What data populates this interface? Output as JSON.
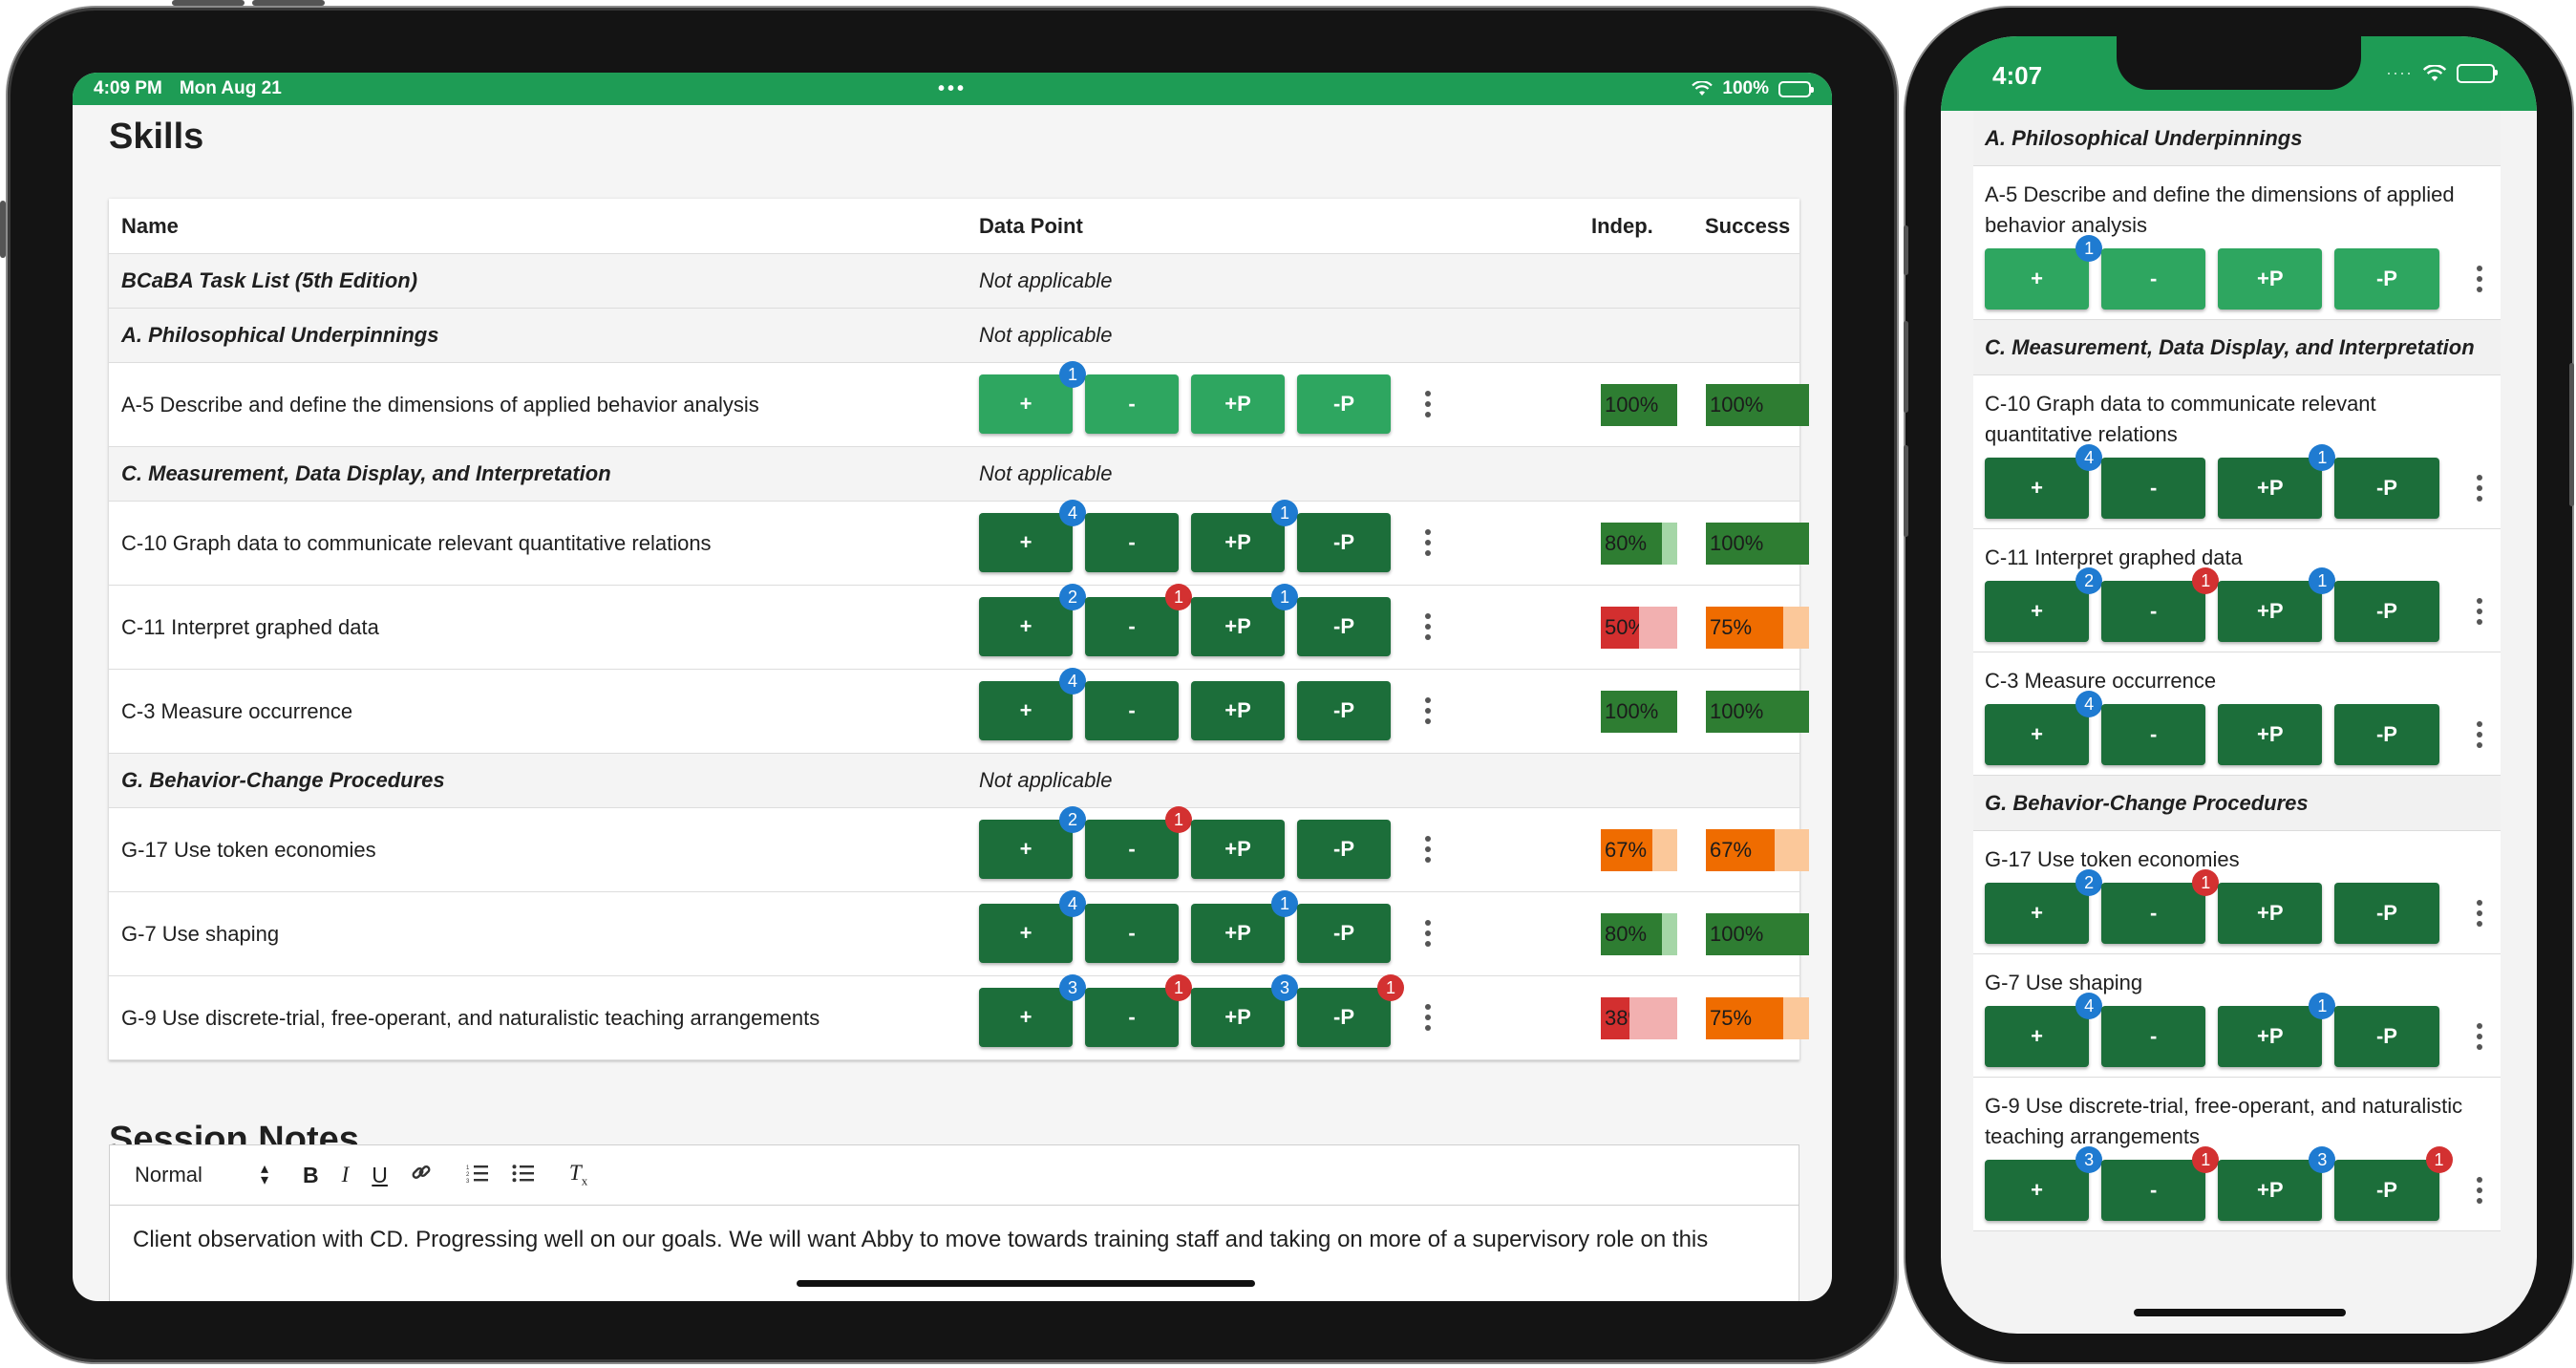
{
  "ipad": {
    "status": {
      "time": "4:09 PM",
      "date": "Mon Aug 21",
      "battery": "100%"
    },
    "skills_title": "Skills",
    "table_headers": {
      "name": "Name",
      "data_point": "Data Point",
      "indep": "Indep.",
      "success": "Success"
    },
    "rows": [
      {
        "type": "group",
        "name": "BCaBA Task List (5th Edition)",
        "data_point": "Not applicable"
      },
      {
        "type": "group",
        "name": "A. Philosophical Underpinnings",
        "data_point": "Not applicable"
      },
      {
        "type": "skill",
        "name": "A-5 Describe and define the dimensions of applied behavior analysis",
        "style": "light",
        "buttons": [
          {
            "label": "+",
            "badge": "1",
            "badge_color": "blue"
          },
          {
            "label": "-"
          },
          {
            "label": "+P"
          },
          {
            "label": "-P"
          }
        ],
        "indep": {
          "label": "100%",
          "value": 1.0,
          "fg": "#2e7d32",
          "bg": "#a5d6a7"
        },
        "success": {
          "label": "100%",
          "value": 1.0,
          "fg": "#2e7d32",
          "bg": "#a5d6a7"
        }
      },
      {
        "type": "group",
        "name": "C. Measurement, Data Display, and Interpretation",
        "data_point": "Not applicable"
      },
      {
        "type": "skill",
        "name": "C-10 Graph data to communicate relevant quantitative relations",
        "style": "dark",
        "buttons": [
          {
            "label": "+",
            "badge": "4",
            "badge_color": "blue"
          },
          {
            "label": "-"
          },
          {
            "label": "+P",
            "badge": "1",
            "badge_color": "blue"
          },
          {
            "label": "-P"
          }
        ],
        "indep": {
          "label": "80%",
          "value": 0.8,
          "fg": "#2e7d32",
          "bg": "#a5d6a7"
        },
        "success": {
          "label": "100%",
          "value": 1.0,
          "fg": "#2e7d32",
          "bg": "#a5d6a7"
        }
      },
      {
        "type": "skill",
        "name": "C-11 Interpret graphed data",
        "style": "dark",
        "buttons": [
          {
            "label": "+",
            "badge": "2",
            "badge_color": "blue"
          },
          {
            "label": "-",
            "badge": "1",
            "badge_color": "red"
          },
          {
            "label": "+P",
            "badge": "1",
            "badge_color": "blue"
          },
          {
            "label": "-P"
          }
        ],
        "indep": {
          "label": "50%",
          "value": 0.5,
          "fg": "#d32f2f",
          "bg": "#f2b0b0"
        },
        "success": {
          "label": "75%",
          "value": 0.75,
          "fg": "#ef6c00",
          "bg": "#fbc89a"
        }
      },
      {
        "type": "skill",
        "name": "C-3 Measure occurrence",
        "style": "dark",
        "buttons": [
          {
            "label": "+",
            "badge": "4",
            "badge_color": "blue"
          },
          {
            "label": "-"
          },
          {
            "label": "+P"
          },
          {
            "label": "-P"
          }
        ],
        "indep": {
          "label": "100%",
          "value": 1.0,
          "fg": "#2e7d32",
          "bg": "#a5d6a7"
        },
        "success": {
          "label": "100%",
          "value": 1.0,
          "fg": "#2e7d32",
          "bg": "#a5d6a7"
        }
      },
      {
        "type": "group",
        "name": "G. Behavior-Change Procedures",
        "data_point": "Not applicable"
      },
      {
        "type": "skill",
        "name": "G-17 Use token economies",
        "style": "dark",
        "buttons": [
          {
            "label": "+",
            "badge": "2",
            "badge_color": "blue"
          },
          {
            "label": "-",
            "badge": "1",
            "badge_color": "red"
          },
          {
            "label": "+P"
          },
          {
            "label": "-P"
          }
        ],
        "indep": {
          "label": "67%",
          "value": 0.67,
          "fg": "#ef6c00",
          "bg": "#fbc89a"
        },
        "success": {
          "label": "67%",
          "value": 0.67,
          "fg": "#ef6c00",
          "bg": "#fbc89a"
        }
      },
      {
        "type": "skill",
        "name": "G-7 Use shaping",
        "style": "dark",
        "buttons": [
          {
            "label": "+",
            "badge": "4",
            "badge_color": "blue"
          },
          {
            "label": "-"
          },
          {
            "label": "+P",
            "badge": "1",
            "badge_color": "blue"
          },
          {
            "label": "-P"
          }
        ],
        "indep": {
          "label": "80%",
          "value": 0.8,
          "fg": "#2e7d32",
          "bg": "#a5d6a7"
        },
        "success": {
          "label": "100%",
          "value": 1.0,
          "fg": "#2e7d32",
          "bg": "#a5d6a7"
        }
      },
      {
        "type": "skill",
        "name": "G-9 Use discrete-trial, free-operant, and naturalistic teaching arrangements",
        "style": "dark",
        "buttons": [
          {
            "label": "+",
            "badge": "3",
            "badge_color": "blue"
          },
          {
            "label": "-",
            "badge": "1",
            "badge_color": "red"
          },
          {
            "label": "+P",
            "badge": "3",
            "badge_color": "blue"
          },
          {
            "label": "-P",
            "badge": "1",
            "badge_color": "red"
          }
        ],
        "indep": {
          "label": "38%",
          "value": 0.38,
          "fg": "#d32f2f",
          "bg": "#f2b0b0"
        },
        "success": {
          "label": "75%",
          "value": 0.75,
          "fg": "#ef6c00",
          "bg": "#fbc89a"
        }
      }
    ],
    "notes_title": "Session Notes",
    "editor": {
      "format": "Normal",
      "text": "Client observation with CD. Progressing well on our goals. We will want Abby to move towards training staff and taking on more of a supervisory role on this"
    }
  },
  "iphone": {
    "status": {
      "time": "4:07"
    },
    "rows": [
      {
        "type": "group",
        "name": "A. Philosophical Underpinnings"
      },
      {
        "type": "skill",
        "name": "A-5 Describe and define the dimensions of applied behavior analysis",
        "style": "light",
        "buttons": [
          {
            "label": "+",
            "badge": "1",
            "badge_color": "blue"
          },
          {
            "label": "-"
          },
          {
            "label": "+P"
          },
          {
            "label": "-P"
          }
        ]
      },
      {
        "type": "group",
        "name": "C. Measurement, Data Display, and Interpretation"
      },
      {
        "type": "skill",
        "name": "C-10 Graph data to communicate relevant quantitative relations",
        "style": "dark",
        "buttons": [
          {
            "label": "+",
            "badge": "4",
            "badge_color": "blue"
          },
          {
            "label": "-"
          },
          {
            "label": "+P",
            "badge": "1",
            "badge_color": "blue"
          },
          {
            "label": "-P"
          }
        ]
      },
      {
        "type": "skill",
        "name": "C-11 Interpret graphed data",
        "style": "dark",
        "buttons": [
          {
            "label": "+",
            "badge": "2",
            "badge_color": "blue"
          },
          {
            "label": "-",
            "badge": "1",
            "badge_color": "red"
          },
          {
            "label": "+P",
            "badge": "1",
            "badge_color": "blue"
          },
          {
            "label": "-P"
          }
        ]
      },
      {
        "type": "skill",
        "name": "C-3 Measure occurrence",
        "style": "dark",
        "buttons": [
          {
            "label": "+",
            "badge": "4",
            "badge_color": "blue"
          },
          {
            "label": "-"
          },
          {
            "label": "+P"
          },
          {
            "label": "-P"
          }
        ]
      },
      {
        "type": "group",
        "name": "G. Behavior-Change Procedures"
      },
      {
        "type": "skill",
        "name": "G-17 Use token economies",
        "style": "dark",
        "buttons": [
          {
            "label": "+",
            "badge": "2",
            "badge_color": "blue"
          },
          {
            "label": "-",
            "badge": "1",
            "badge_color": "red"
          },
          {
            "label": "+P"
          },
          {
            "label": "-P"
          }
        ]
      },
      {
        "type": "skill",
        "name": "G-7 Use shaping",
        "style": "dark",
        "buttons": [
          {
            "label": "+",
            "badge": "4",
            "badge_color": "blue"
          },
          {
            "label": "-"
          },
          {
            "label": "+P",
            "badge": "1",
            "badge_color": "blue"
          },
          {
            "label": "-P"
          }
        ]
      },
      {
        "type": "skill",
        "name": "G-9 Use discrete-trial, free-operant, and naturalistic teaching arrangements",
        "style": "dark",
        "buttons": [
          {
            "label": "+",
            "badge": "3",
            "badge_color": "blue"
          },
          {
            "label": "-",
            "badge": "1",
            "badge_color": "red"
          },
          {
            "label": "+P",
            "badge": "3",
            "badge_color": "blue"
          },
          {
            "label": "-P",
            "badge": "1",
            "badge_color": "red"
          }
        ]
      }
    ]
  }
}
